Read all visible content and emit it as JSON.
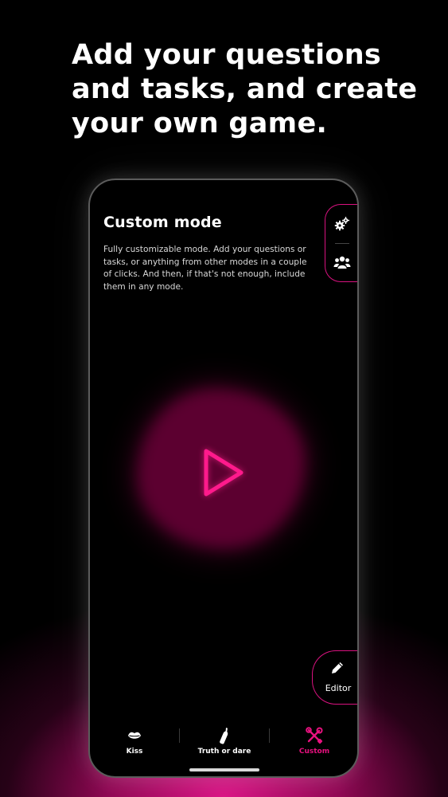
{
  "headline": {
    "line1": "Add your questions",
    "line2": "and tasks, and create",
    "line3": "your own game."
  },
  "mode": {
    "title": "Custom mode",
    "description": "Fully customizable mode. Add your questions or tasks, or anything from other modes in a couple of clicks. And then, if that's not enough, include them in any mode."
  },
  "side_panel": {
    "settings_icon": "gears-icon",
    "players_icon": "group-icon"
  },
  "play": {
    "icon": "play-icon"
  },
  "editor": {
    "label": "Editor",
    "icon": "pencil-icon"
  },
  "tabs": [
    {
      "label": "Kiss",
      "icon": "lips-icon",
      "active": false
    },
    {
      "label": "Truth or dare",
      "icon": "bottle-icon",
      "active": false
    },
    {
      "label": "Custom",
      "icon": "tools-icon",
      "active": true
    }
  ],
  "colors": {
    "accent": "#e8117f",
    "background": "#000000",
    "text": "#ffffff"
  }
}
